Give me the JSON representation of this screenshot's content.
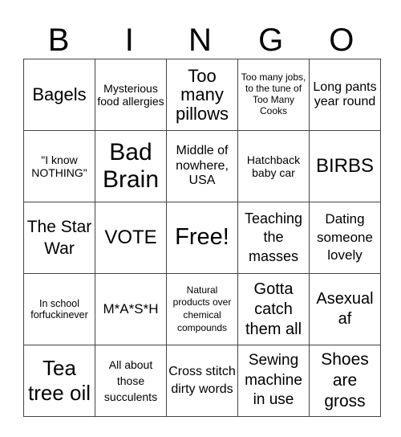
{
  "header": {
    "letters": [
      "B",
      "I",
      "N",
      "G",
      "O"
    ]
  },
  "grid": {
    "rows": [
      [
        "Bagels",
        "Mysterious food allergies",
        "Too many pillows",
        "Too many jobs, to the tune of Too Many Cooks",
        "Long pants year round"
      ],
      [
        "\"I know NOTHING\"",
        "Bad Brain",
        "Middle of nowhere, USA",
        "Hatchback baby car",
        "BIRBS"
      ],
      [
        "The Star War",
        "VOTE",
        "Free!",
        "Teaching the masses",
        "Dating someone lovely"
      ],
      [
        "In school forfuckinever",
        "M*A*S*H",
        "Natural products over chemical compounds",
        "Gotta catch them all",
        "Asexual af"
      ],
      [
        "Tea tree oil",
        "All about those succulents",
        "Cross stitch dirty words",
        "Sewing machine in use",
        "Shoes are gross"
      ]
    ]
  }
}
